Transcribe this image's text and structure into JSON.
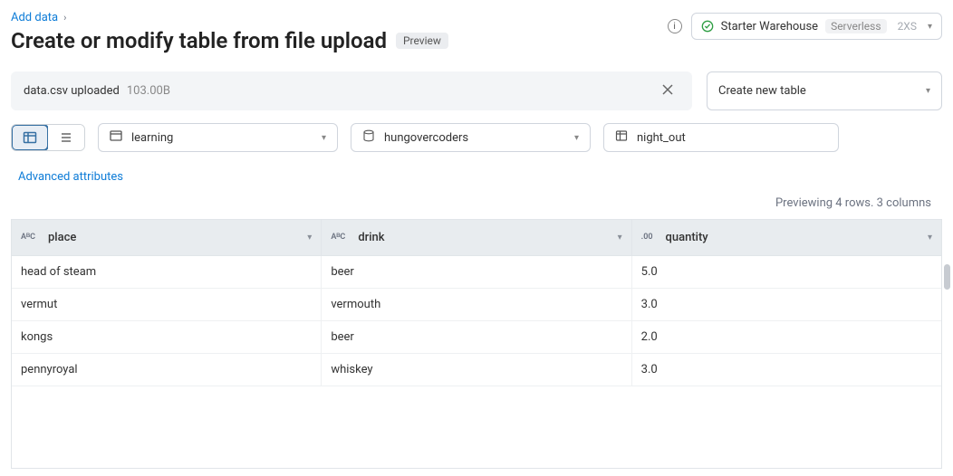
{
  "breadcrumb": {
    "parent": "Add data"
  },
  "title": "Create or modify table from file upload",
  "preview_badge": "Preview",
  "warehouse": {
    "name": "Starter Warehouse",
    "type": "Serverless",
    "size": "2XS"
  },
  "upload": {
    "filename": "data.csv uploaded",
    "size": "103.00B"
  },
  "action_select": {
    "label": "Create new table"
  },
  "catalog": {
    "value": "learning"
  },
  "schema": {
    "value": "hungovercoders"
  },
  "table": {
    "value": "night_out"
  },
  "advanced_link": "Advanced attributes",
  "preview_status": "Previewing 4 rows. 3 columns",
  "columns": [
    {
      "name": "place",
      "type": "string"
    },
    {
      "name": "drink",
      "type": "string"
    },
    {
      "name": "quantity",
      "type": "number"
    }
  ],
  "rows": [
    {
      "place": "head of steam",
      "drink": "beer",
      "quantity": "5.0"
    },
    {
      "place": "vermut",
      "drink": "vermouth",
      "quantity": "3.0"
    },
    {
      "place": "kongs",
      "drink": "beer",
      "quantity": "2.0"
    },
    {
      "place": "pennyroyal",
      "drink": "whiskey",
      "quantity": "3.0"
    }
  ],
  "type_labels": {
    "string": "AᴮC",
    "number": ".00"
  }
}
